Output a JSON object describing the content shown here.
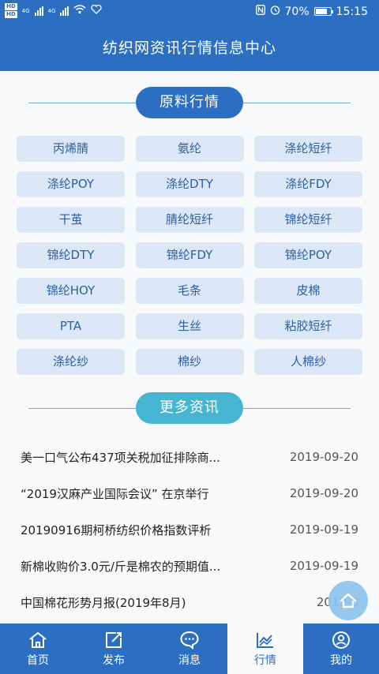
{
  "status_bar": {
    "hd1": "HD",
    "hd2": "HD",
    "net1": "4G",
    "net2": "4G",
    "battery": "70%",
    "time": "15:15",
    "battery_level": 0.7
  },
  "header": {
    "title": "纺织网资讯行情信息中心"
  },
  "raw_section": {
    "title": "原料行情",
    "items": [
      "丙烯腈",
      "氨纶",
      "涤纶短纤",
      "涤纶POY",
      "涤纶DTY",
      "涤纶FDY",
      "干茧",
      "腈纶短纤",
      "锦纶短纤",
      "锦纶DTY",
      "锦纶FDY",
      "锦纶POY",
      "锦纶HOY",
      "毛条",
      "皮棉",
      "PTA",
      "生丝",
      "粘胶短纤",
      "涤纶纱",
      "棉纱",
      "人棉纱"
    ]
  },
  "more_section": {
    "title": "更多资讯"
  },
  "news": [
    {
      "title": "美一口气公布437项关税加征排除商...",
      "date": "2019-09-20"
    },
    {
      "title": "“2019汉麻产业国际会议” 在京举行",
      "date": "2019-09-20"
    },
    {
      "title": "20190916期柯桥纺织价格指数评析",
      "date": "2019-09-19"
    },
    {
      "title": "新棉收购价3.0元/斤是棉农的预期值...",
      "date": "2019-09-19"
    },
    {
      "title": "中国棉花形势月报(2019年8月)",
      "date": "2019-0"
    }
  ],
  "bottom_nav": [
    {
      "label": "首页",
      "icon": "home-icon"
    },
    {
      "label": "发布",
      "icon": "publish-icon"
    },
    {
      "label": "消息",
      "icon": "message-icon"
    },
    {
      "label": "行情",
      "icon": "chart-icon",
      "active": true
    },
    {
      "label": "我的",
      "icon": "profile-icon"
    }
  ],
  "colors": {
    "primary": "#2c6fc2",
    "accent": "#45b5d1",
    "chip_bg": "#dbe7f6"
  }
}
